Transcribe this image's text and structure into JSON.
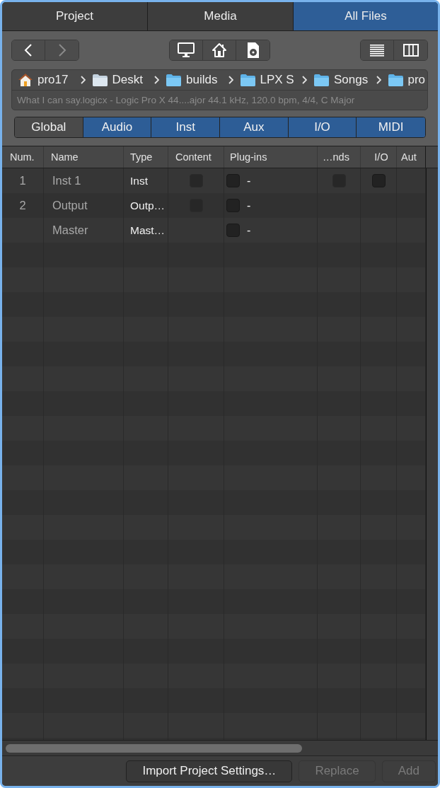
{
  "tabs": [
    {
      "label": "Project",
      "selected": false
    },
    {
      "label": "Media",
      "selected": false
    },
    {
      "label": "All Files",
      "selected": true
    }
  ],
  "navigation": {
    "back": {
      "disabled": false
    },
    "forward": {
      "disabled": true
    }
  },
  "path": {
    "items": [
      {
        "kind": "home",
        "label": "pro17"
      },
      {
        "kind": "desktop",
        "label": "Deskt"
      },
      {
        "kind": "folder",
        "label": "builds"
      },
      {
        "kind": "folder",
        "label": "LPX S"
      },
      {
        "kind": "folder",
        "label": "Songs"
      },
      {
        "kind": "folder",
        "label": "pro"
      }
    ],
    "info": "What I can say.logicx - Logic Pro X 44....ajor 44.1 kHz, 120.0 bpm, 4/4, C Major"
  },
  "filters": [
    {
      "label": "Global",
      "selected": false
    },
    {
      "label": "Audio",
      "selected": true
    },
    {
      "label": "Inst",
      "selected": true
    },
    {
      "label": "Aux",
      "selected": true
    },
    {
      "label": "I/O",
      "selected": true
    },
    {
      "label": "MIDI",
      "selected": true
    }
  ],
  "table": {
    "columns": [
      "Num.",
      "Name",
      "Type",
      "Content",
      "Plug-ins",
      "…nds",
      "I/O",
      "Aut"
    ],
    "rows": [
      {
        "num": "1",
        "name": "Inst 1",
        "type": "Inst",
        "content": {
          "checked": false,
          "disabled": true
        },
        "plugins": {
          "checked": false,
          "disabled": false,
          "value": "-"
        },
        "sends": {
          "checked": false,
          "disabled": true
        },
        "io": {
          "checked": false,
          "disabled": false
        }
      },
      {
        "num": "2",
        "name": "Output",
        "type": "Outp…",
        "content": {
          "checked": false,
          "disabled": true
        },
        "plugins": {
          "checked": false,
          "disabled": false,
          "value": "-"
        }
      },
      {
        "name": "Master",
        "type": "Mast…",
        "plugins": {
          "checked": false,
          "disabled": false,
          "value": "-"
        }
      }
    ]
  },
  "buttons": [
    {
      "label": "Import Project Settings…",
      "disabled": false
    },
    {
      "label": "Replace",
      "disabled": true
    },
    {
      "label": "Add",
      "disabled": true
    }
  ]
}
